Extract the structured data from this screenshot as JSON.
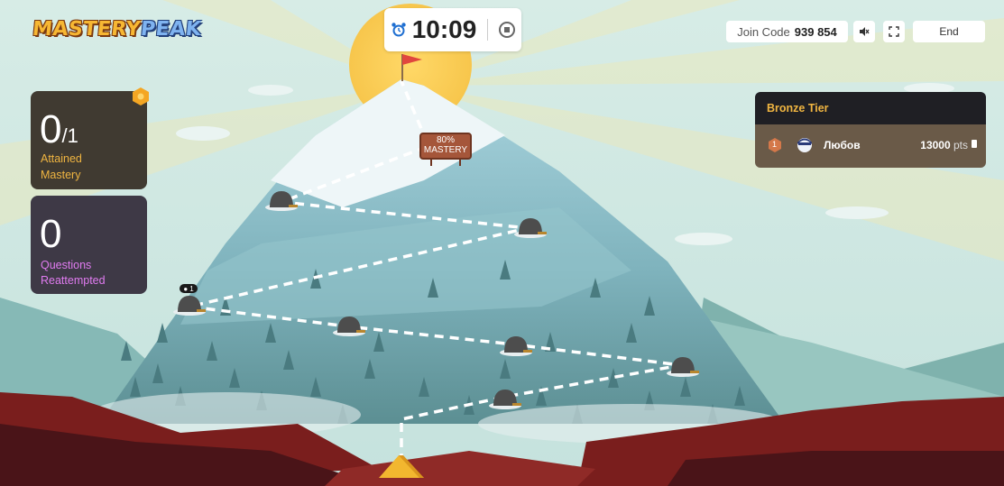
{
  "header": {
    "logo_part1": "MASTERY",
    "logo_part2": "PEAK",
    "timer": "10:09",
    "join_label": "Join Code",
    "join_code": "939 854",
    "end_label": "End"
  },
  "stats": {
    "mastery_value": "0",
    "mastery_total": "/1",
    "mastery_label_1": "Attained",
    "mastery_label_2": "Mastery",
    "reattempted_value": "0",
    "reattempted_label_1": "Questions",
    "reattempted_label_2": "Reattempted"
  },
  "leaderboard": {
    "tier": "Bronze Tier",
    "rows": [
      {
        "rank": "1",
        "name": "Любов",
        "points": "13000",
        "unit": "pts"
      }
    ]
  },
  "mountain": {
    "sign_line1": "80%",
    "sign_line2": "MASTERY",
    "camp_counter": "1"
  },
  "colors": {
    "sky": "#cfe8e4",
    "mastery_accent": "#f0b541",
    "reattempt_accent": "#e07bf0",
    "leader_row": "#6a5a48"
  },
  "icons": [
    "alarm-clock-icon",
    "stop-icon",
    "mute-icon",
    "fullscreen-icon",
    "trash-icon",
    "rank-badge-icon",
    "avatar-icon",
    "flag-icon",
    "tent-icon",
    "cave-icon"
  ]
}
